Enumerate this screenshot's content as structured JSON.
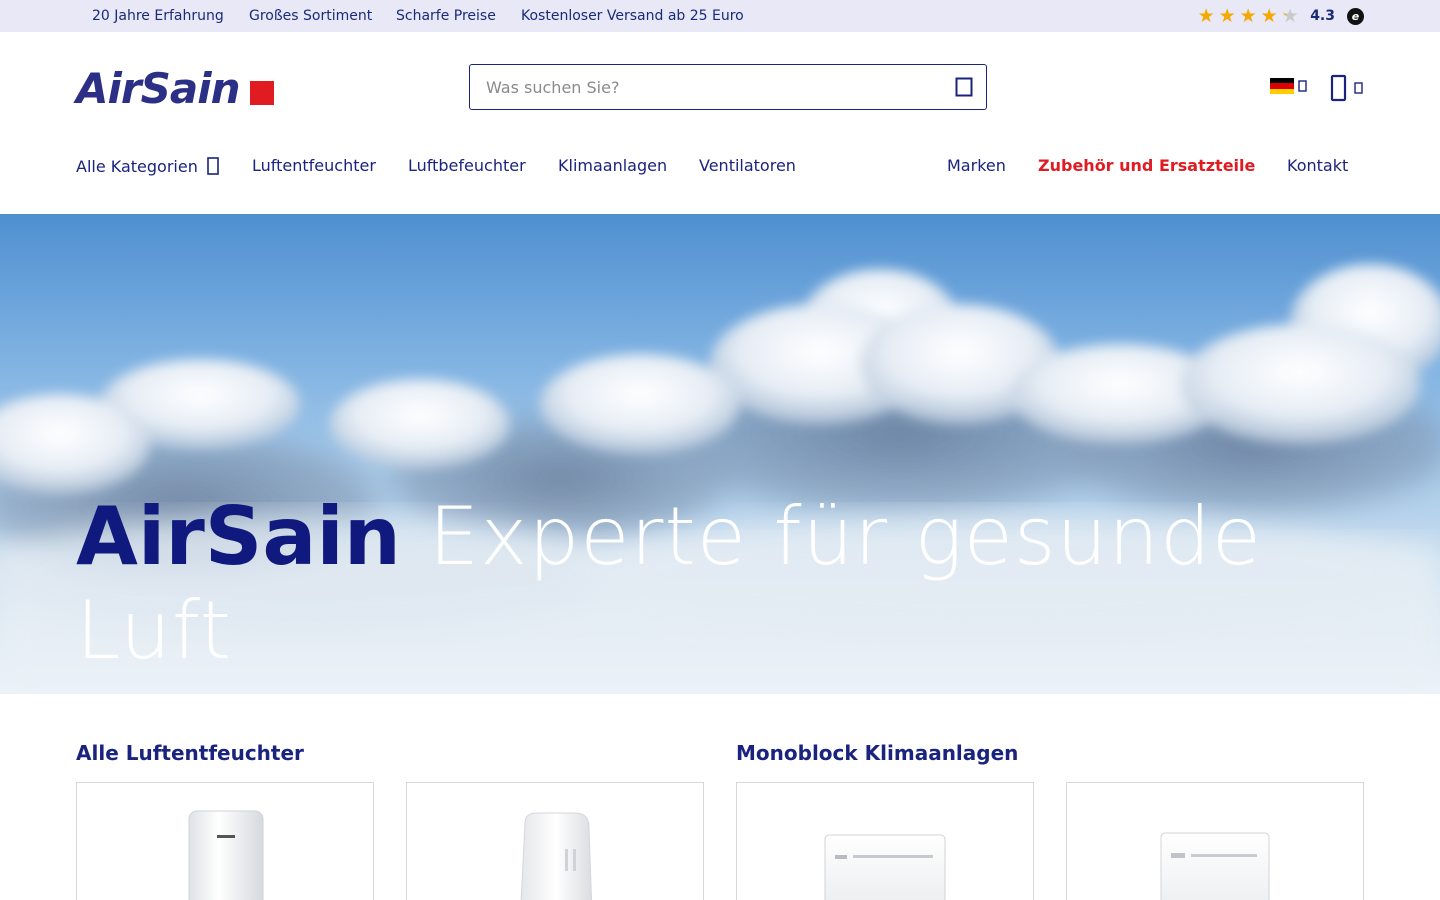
{
  "topbar": {
    "usps": [
      "20 Jahre Erfahrung",
      "Großes Sortiment",
      "Scharfe Preise",
      "Kostenloser Versand ab 25 Euro"
    ],
    "rating": {
      "value": "4.3",
      "stars": 4.3,
      "max_stars": 5,
      "badge": "e"
    }
  },
  "header": {
    "logo": {
      "text": "AirSain",
      "brand_color": "#2b2f86",
      "accent_color": "#e01b22"
    },
    "search": {
      "placeholder": "Was suchen Sie?",
      "icon": "search-icon"
    },
    "language": {
      "flag": "germany-flag-icon",
      "icon": "chevron-down-icon"
    },
    "cart": {
      "icon": "cart-icon"
    }
  },
  "nav": {
    "left": [
      {
        "label": "Alle Kategorien",
        "icon": "chevron-down-icon"
      },
      {
        "label": "Luftentfeuchter"
      },
      {
        "label": "Luftbefeuchter"
      },
      {
        "label": "Klimaanlagen"
      },
      {
        "label": "Ventilatoren"
      }
    ],
    "right": [
      {
        "label": "Marken"
      },
      {
        "label": "Zubehör und Ersatzteile",
        "accent": true
      },
      {
        "label": "Kontakt"
      }
    ],
    "accent_color": "#e01b22"
  },
  "hero": {
    "brand": "AirSain",
    "tagline": "Experte für gesunde Luft",
    "brand_color": "#101a7e"
  },
  "sections": [
    {
      "title": "Alle Luftentfeuchter",
      "products": [
        "dehumidifier-image",
        "dehumidifier-image"
      ]
    },
    {
      "title": "Monoblock Klimaanlagen",
      "products": [
        "air-conditioner-image",
        "air-conditioner-image"
      ]
    }
  ]
}
